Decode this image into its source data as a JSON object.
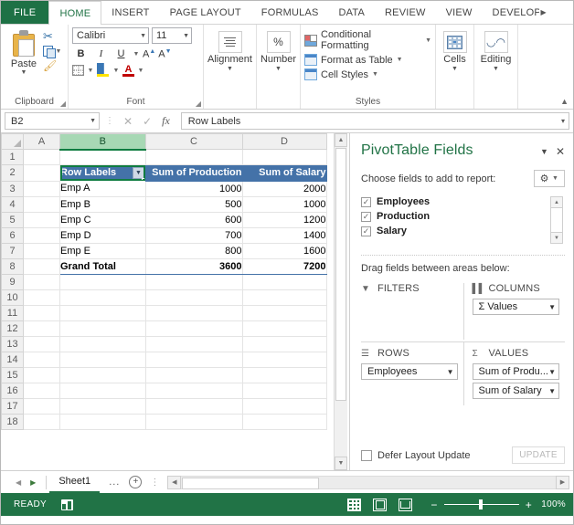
{
  "ribbon": {
    "file_tab": "FILE",
    "tabs": [
      {
        "label": "HOME",
        "active": true
      },
      {
        "label": "INSERT",
        "active": false
      },
      {
        "label": "PAGE LAYOUT",
        "active": false
      },
      {
        "label": "FORMULAS",
        "active": false
      },
      {
        "label": "DATA",
        "active": false
      },
      {
        "label": "REVIEW",
        "active": false
      },
      {
        "label": "VIEW",
        "active": false
      },
      {
        "label": "DEVELOPER",
        "active": false
      }
    ],
    "clipboard": {
      "group_label": "Clipboard",
      "paste_label": "Paste",
      "cut_icon": "scissors-icon",
      "copy_icon": "copy-icon",
      "format_painter_icon": "format-painter-icon"
    },
    "font": {
      "group_label": "Font",
      "font_name": "Calibri",
      "font_size": "11",
      "bold": "B",
      "italic": "I",
      "underline": "U",
      "grow_font": "A",
      "shrink_font": "A",
      "borders_icon": "borders-icon",
      "fill_color_icon": "fill-color-icon",
      "font_color_icon": "font-color-icon"
    },
    "alignment": {
      "group_label": "Alignment",
      "button_label": "Alignment"
    },
    "number": {
      "group_label": "Number",
      "button_label": "Number",
      "percent": "%"
    },
    "styles": {
      "group_label": "Styles",
      "items": [
        {
          "label": "Conditional Formatting",
          "icon": "conditional-formatting-icon"
        },
        {
          "label": "Format as Table",
          "icon": "format-as-table-icon"
        },
        {
          "label": "Cell Styles",
          "icon": "cell-styles-icon"
        }
      ]
    },
    "cells": {
      "label": "Cells",
      "icon": "cells-icon"
    },
    "editing": {
      "label": "Editing",
      "icon": "binoculars-icon"
    }
  },
  "formula_bar": {
    "name_box": "B2",
    "cancel_icon": "cancel-icon",
    "enter_icon": "check-icon",
    "function_icon": "fx",
    "formula_value": "Row Labels"
  },
  "grid": {
    "columns": [
      "A",
      "B",
      "C",
      "D"
    ],
    "selected_column": "B",
    "rows": [
      "1",
      "2",
      "3",
      "4",
      "5",
      "6",
      "7",
      "8",
      "9",
      "10",
      "11",
      "12",
      "13",
      "14",
      "15",
      "16",
      "17",
      "18"
    ],
    "selected_cell": "B2",
    "pivot": {
      "header_row_label": "Row Labels",
      "header_dropdown_icon": "filter-dropdown-icon",
      "headers": [
        "Sum of Production",
        "Sum of Salary"
      ],
      "data": [
        {
          "label": "Emp A",
          "production": "1000",
          "salary": "2000"
        },
        {
          "label": "Emp B",
          "production": "500",
          "salary": "1000"
        },
        {
          "label": "Emp C",
          "production": "600",
          "salary": "1200"
        },
        {
          "label": "Emp D",
          "production": "700",
          "salary": "1400"
        },
        {
          "label": "Emp E",
          "production": "800",
          "salary": "1600"
        }
      ],
      "total": {
        "label": "Grand Total",
        "production": "3600",
        "salary": "7200"
      }
    }
  },
  "pivot_pane": {
    "title": "PivotTable Fields",
    "collapse_icon": "chevron-down-icon",
    "close_icon": "close-icon",
    "choose_label": "Choose fields to add to report:",
    "tools_icon": "gear-icon",
    "tools_caret": "chevron-down-icon",
    "fields": [
      {
        "label": "Employees",
        "checked": true
      },
      {
        "label": "Production",
        "checked": true
      },
      {
        "label": "Salary",
        "checked": true
      }
    ],
    "drag_label": "Drag fields between areas below:",
    "areas": {
      "filters": {
        "name": "FILTERS",
        "icon": "filter-icon",
        "items": []
      },
      "columns": {
        "name": "COLUMNS",
        "icon": "columns-icon",
        "items": [
          "Σ Values"
        ]
      },
      "rows": {
        "name": "ROWS",
        "icon": "rows-icon",
        "items": [
          "Employees"
        ]
      },
      "values": {
        "name": "VALUES",
        "icon": "sigma-icon",
        "items": [
          "Sum of Produ...",
          "Sum of Salary"
        ]
      }
    },
    "defer_label": "Defer Layout Update",
    "defer_checked": false,
    "update_button": "UPDATE"
  },
  "sheet_bar": {
    "prev_icon": "prev-sheet-icon",
    "next_icon": "next-sheet-icon",
    "tabs": [
      "Sheet1"
    ],
    "overflow": "...",
    "add_sheet_icon": "plus-icon",
    "menu_icon": "vertical-dots-icon"
  },
  "status_bar": {
    "state": "READY",
    "macro_icon": "record-macro-icon",
    "views": [
      {
        "name": "normal-view-icon"
      },
      {
        "name": "page-layout-view-icon"
      },
      {
        "name": "page-break-view-icon"
      }
    ],
    "zoom_out": "−",
    "zoom_in": "+",
    "zoom_level": "100%"
  },
  "colors": {
    "excel_green": "#217346",
    "pivot_header_blue": "#4472a8",
    "selection_green": "#107c41"
  }
}
